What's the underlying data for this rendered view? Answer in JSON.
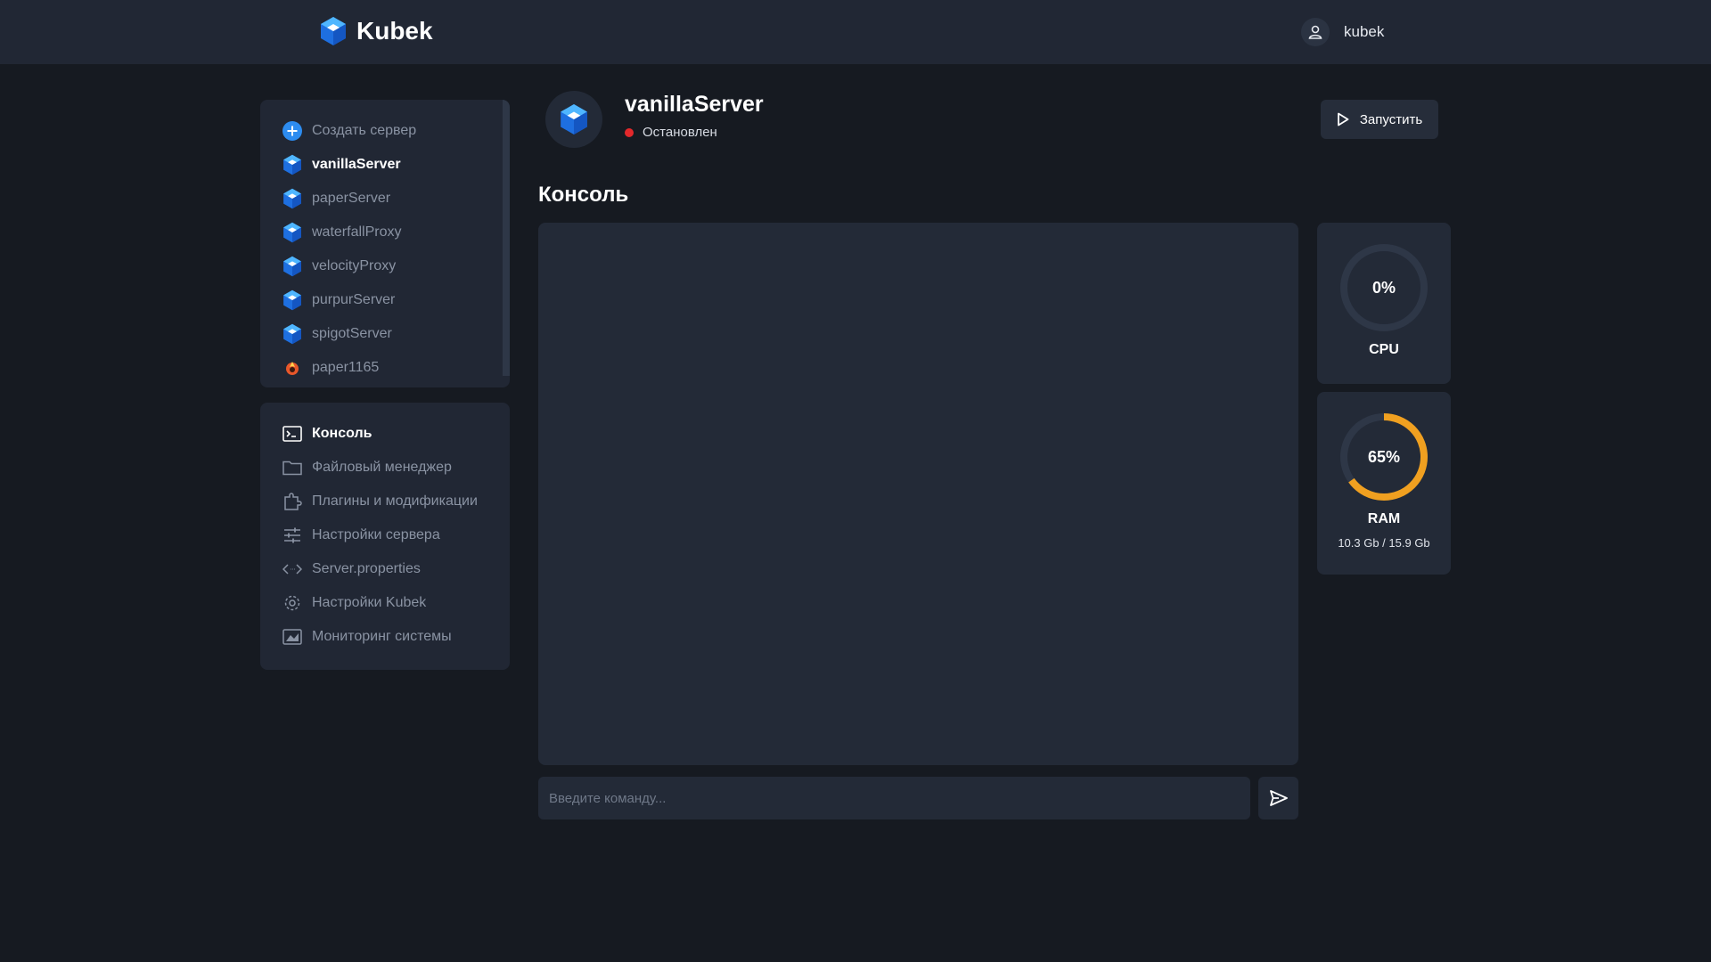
{
  "app": {
    "name": "Kubek"
  },
  "user": {
    "name": "kubek"
  },
  "servers": {
    "create_label": "Создать сервер",
    "items": [
      {
        "label": "vanillaServer",
        "active": true
      },
      {
        "label": "paperServer"
      },
      {
        "label": "waterfallProxy"
      },
      {
        "label": "velocityProxy"
      },
      {
        "label": "purpurServer"
      },
      {
        "label": "spigotServer"
      },
      {
        "label": "paper1165"
      }
    ]
  },
  "nav": {
    "items": [
      {
        "label": "Консоль",
        "icon": "console-icon",
        "active": true
      },
      {
        "label": "Файловый менеджер",
        "icon": "folder-icon"
      },
      {
        "label": "Плагины и модификации",
        "icon": "puzzle-icon"
      },
      {
        "label": "Настройки сервера",
        "icon": "sliders-icon"
      },
      {
        "label": "Server.properties",
        "icon": "code-icon"
      },
      {
        "label": "Настройки Kubek",
        "icon": "gear-icon"
      },
      {
        "label": "Мониторинг системы",
        "icon": "chart-icon"
      }
    ]
  },
  "server": {
    "name": "vanillaServer",
    "status": "Остановлен",
    "status_color": "#e3282b",
    "start_label": "Запустить"
  },
  "console": {
    "title": "Консоль",
    "input_placeholder": "Введите команду..."
  },
  "stats": {
    "cpu": {
      "value": "0%",
      "percent": 0,
      "label": "CPU"
    },
    "ram": {
      "value": "65%",
      "percent": 65,
      "label": "RAM",
      "detail": "10.3 Gb / 15.9 Gb",
      "color": "#f0a020"
    }
  },
  "colors": {
    "accent": "#2d8cf0",
    "gauge_track": "#2e3747",
    "ram_gauge": "#f0a020"
  }
}
